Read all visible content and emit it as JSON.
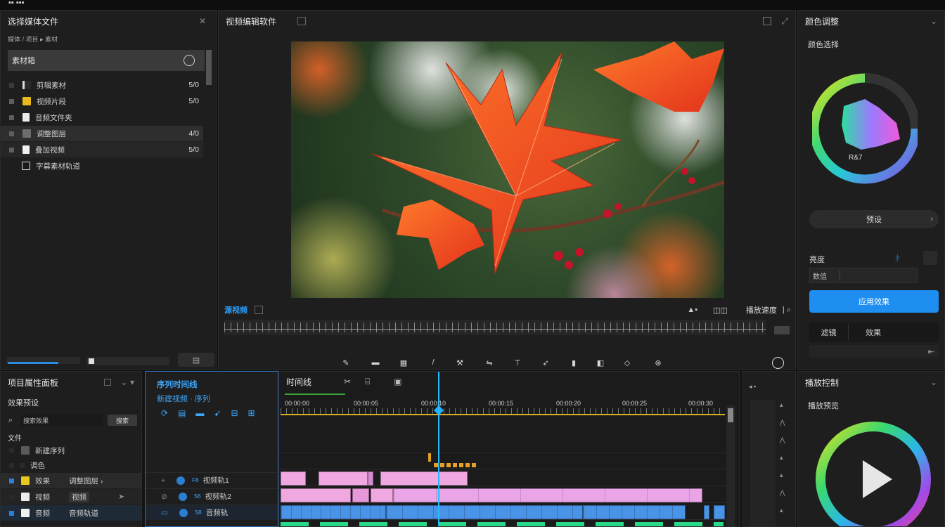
{
  "topbar": {
    "title": "▪▪ ▪▪▪"
  },
  "media": {
    "title": "选择媒体文件",
    "path": "媒体 / 项目 ▸ 素材",
    "bin_label": "素材箱",
    "items": [
      {
        "label": "剪辑素材",
        "value": "5/0"
      },
      {
        "label": "视频片段",
        "value": "5/0"
      },
      {
        "label": "音频文件夹"
      },
      {
        "label": "调整图层",
        "value": "4/0"
      },
      {
        "label": "叠加视频",
        "value": "5/0"
      },
      {
        "label": "字幕素材轨道"
      }
    ],
    "footer_btn": "▤"
  },
  "viewer": {
    "title": "视频编辑软件",
    "label": "源视频",
    "right_label": "播放速度",
    "tools": [
      "pen-icon",
      "minus-icon",
      "stack-icon",
      "slash-icon",
      "hammer-icon",
      "flip-icon",
      "anchor-icon",
      "bird-icon",
      "crop-icon",
      "mask-icon",
      "shape-icon",
      "link-icon"
    ]
  },
  "color": {
    "title": "颜色调整",
    "subtitle": "颜色选择",
    "wheel_label": "R&7",
    "pill_label": "预设",
    "field_label": "亮度",
    "field_value": "数值",
    "apply_btn": "应用效果",
    "tab_a": "滤镜",
    "tab_b": "效果"
  },
  "project": {
    "title": "项目属性面板",
    "section": "效果预设",
    "search_placeholder": "搜索效果",
    "search_btn": "搜索",
    "folder": "文件",
    "items": [
      {
        "label": "新建序列"
      },
      {
        "label": "调色"
      },
      {
        "label": "效果",
        "extra": "调整图层 ›"
      },
      {
        "label": "视频",
        "extra": "视频"
      },
      {
        "label": "音频",
        "extra": "音频轨道"
      }
    ]
  },
  "seqinfo": {
    "title": "序列时间线",
    "subtitle": "新建视频 · 序列"
  },
  "timeline": {
    "title": "时间线",
    "tracks": [
      {
        "label": "视频轨1"
      },
      {
        "label": "视频轨2"
      },
      {
        "label": "音频轨"
      }
    ],
    "time_labels": [
      "00:00:00",
      "00:00:05",
      "00:00:10",
      "00:00:15",
      "00:00:20",
      "00:00:25",
      "00:00:30"
    ]
  },
  "scopes": {
    "title": "◂ ▪"
  },
  "playback": {
    "title": "播放控制",
    "subtitle": "播放预览"
  }
}
